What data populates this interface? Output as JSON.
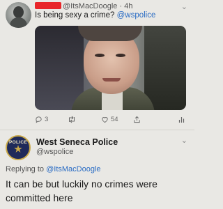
{
  "tweet": {
    "handle": "@ItsMacDoogle",
    "separator": "·",
    "time": "4h",
    "text_prefix": "Is being sexy a crime? ",
    "text_mention": "@wspolice",
    "stats": {
      "replies": "3",
      "likes": "54"
    },
    "redaction_color": "#e8262a"
  },
  "reply": {
    "author_name": "West Seneca Police",
    "author_handle": "@wspolice",
    "badge_text": "POLICE",
    "replying_prefix": "Replying to ",
    "replying_mention": "@ItsMacDoogle",
    "text": "It can be but luckily no crimes were committed here"
  },
  "icons": {
    "reply": "reply-icon",
    "retweet": "retweet-icon",
    "like": "like-icon",
    "share": "share-icon",
    "analytics": "analytics-icon",
    "more": "chevron-down-icon"
  },
  "colors": {
    "mention": "#2a6cc4",
    "badge": "#1f2a5a",
    "badge_trim": "#c9a94a"
  }
}
